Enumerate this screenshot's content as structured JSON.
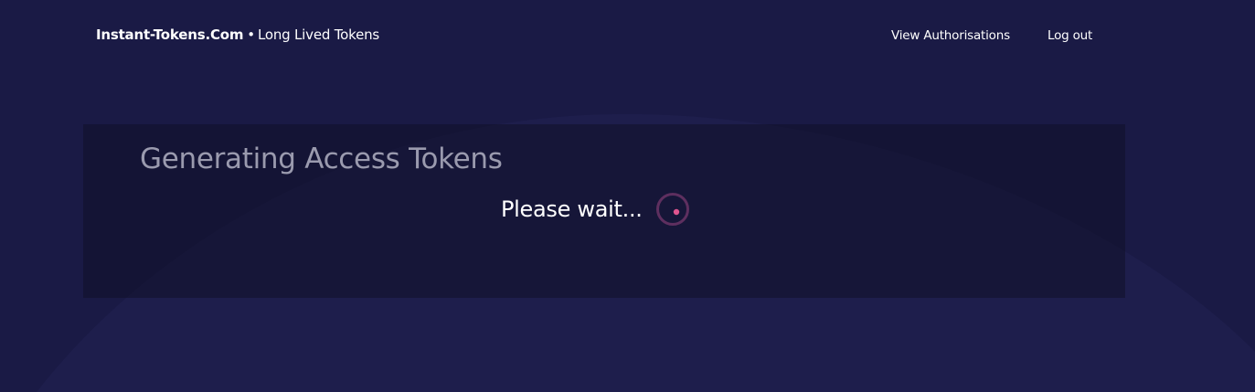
{
  "header": {
    "brand_name": "Instant-Tokens.Com",
    "brand_separator": "•",
    "brand_tagline": "Long Lived Tokens",
    "nav": {
      "view_authorisations": "View Authorisations",
      "log_out": "Log out"
    }
  },
  "main": {
    "title": "Generating Access Tokens",
    "status_text": "Please wait...",
    "spinner_icon": "loading-spinner-icon"
  },
  "colors": {
    "background": "#1a1a45",
    "panel": "#151535",
    "accent": "#e0558f",
    "title_text": "#9a9aae",
    "text": "#ffffff"
  }
}
